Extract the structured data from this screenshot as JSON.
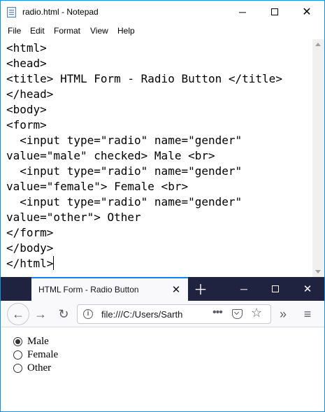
{
  "notepad": {
    "title": "radio.html - Notepad",
    "menu": [
      "File",
      "Edit",
      "Format",
      "View",
      "Help"
    ],
    "code": "<html>\n<head>\n<title> HTML Form - Radio Button </title>\n</head>\n<body>\n<form>\n  <input type=\"radio\" name=\"gender\"\nvalue=\"male\" checked> Male <br>\n  <input type=\"radio\" name=\"gender\"\nvalue=\"female\"> Female <br>\n  <input type=\"radio\" name=\"gender\"\nvalue=\"other\"> Other\n</form>\n</body>\n</html>"
  },
  "browser": {
    "tab_title": "HTML Form - Radio Button",
    "url": "file:///C:/Users/Sarth",
    "radios": [
      {
        "label": "Male",
        "checked": true
      },
      {
        "label": "Female",
        "checked": false
      },
      {
        "label": "Other",
        "checked": false
      }
    ]
  },
  "icons": {
    "notepad_min": "minimize-icon",
    "notepad_max": "maximize-icon",
    "notepad_close": "close-icon",
    "tab_close": "close-icon",
    "new_tab": "plus-icon",
    "back": "arrow-left-icon",
    "forward": "arrow-right-icon",
    "reload": "reload-icon",
    "site_info": "info-icon",
    "page_actions": "more-icon",
    "pocket": "pocket-icon",
    "bookmark": "star-icon",
    "overflow": "chevron-double-right-icon",
    "menu": "hamburger-icon"
  },
  "colors": {
    "window_border": "#1a8fd6",
    "firefox_tabstrip": "#202340",
    "firefox_tab_accent": "#0a84ff"
  }
}
